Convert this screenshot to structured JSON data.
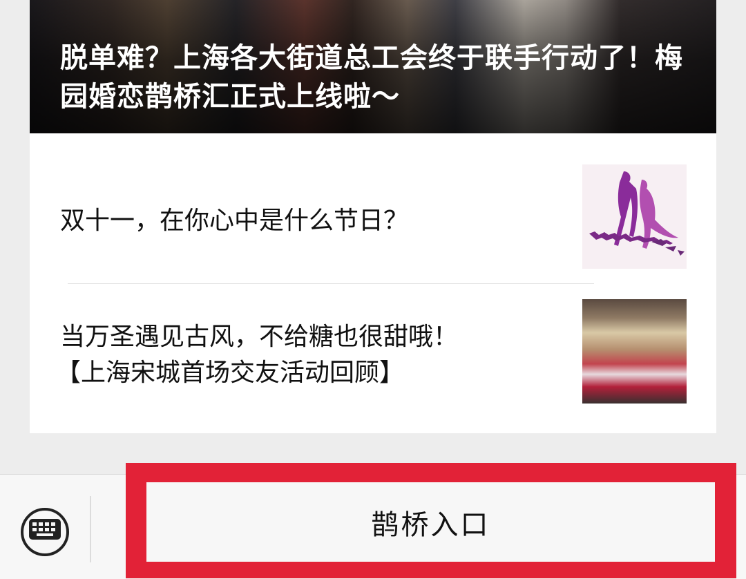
{
  "articles": {
    "featured": {
      "title": "脱单难？上海各大街道总工会终于联手行动了！梅园婚恋鹊桥汇正式上线啦～"
    },
    "items": [
      {
        "title": "双十一，在你心中是什么节日？",
        "subtitle": ""
      },
      {
        "title": "当万圣遇见古风，不给糖也很甜哦！",
        "subtitle": "【上海宋城首场交友活动回顾】"
      }
    ]
  },
  "menu": {
    "keyboard_icon": "keyboard-icon",
    "entry_label": "鹊桥入口",
    "highlight_color": "#e22237"
  }
}
